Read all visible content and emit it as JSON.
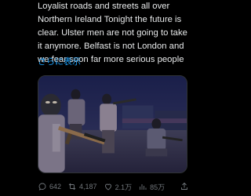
{
  "tweet": {
    "lines": [
      "Loyalist roads and streets all over",
      "Northern Ireland Tonight the future is",
      "clear. Ulster men are not going to take",
      "it anymore. Belfast is not London and",
      "we fear soon far more serious people"
    ],
    "show_more": "さらに表示"
  },
  "actions": {
    "replies": "642",
    "reposts": "4,187",
    "likes": "2.1万",
    "views": "85万"
  },
  "colors": {
    "text": "#e7e9ea",
    "muted": "#71767b",
    "link": "#1d9bf0",
    "background": "#000000"
  }
}
